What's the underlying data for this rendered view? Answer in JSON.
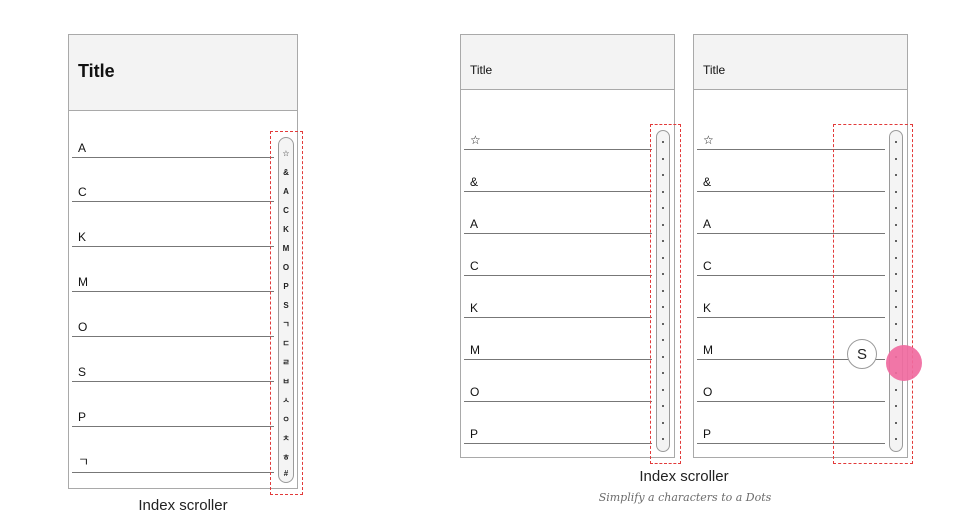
{
  "panel1": {
    "title": "Title",
    "rows": [
      "A",
      "C",
      "K",
      "M",
      "O",
      "S",
      "P",
      "ㄱ"
    ],
    "index_chars": [
      "☆",
      "&",
      "A",
      "C",
      "K",
      "M",
      "O",
      "P",
      "S",
      "ㄱ",
      "ㄷ",
      "ㄹ",
      "ㅂ",
      "ㅅ",
      "ㅇ",
      "ㅊ",
      "ㅎ",
      "#"
    ],
    "caption": "Index scroller"
  },
  "panel2": {
    "title": "Title",
    "rows": [
      "☆",
      "&",
      "A",
      "C",
      "K",
      "M",
      "O",
      "P"
    ]
  },
  "panel3": {
    "title": "Title",
    "rows": [
      "☆",
      "&",
      "A",
      "C",
      "K",
      "M",
      "O",
      "P"
    ],
    "bubble_letter": "S"
  },
  "caption2": {
    "title": "Index scroller",
    "subtitle": "Simplify a characters to a Dots"
  },
  "colors": {
    "highlight_dashed": "#e23a3a",
    "touch_indicator": "#f06aa0",
    "header_bg": "#f3f3f3"
  }
}
